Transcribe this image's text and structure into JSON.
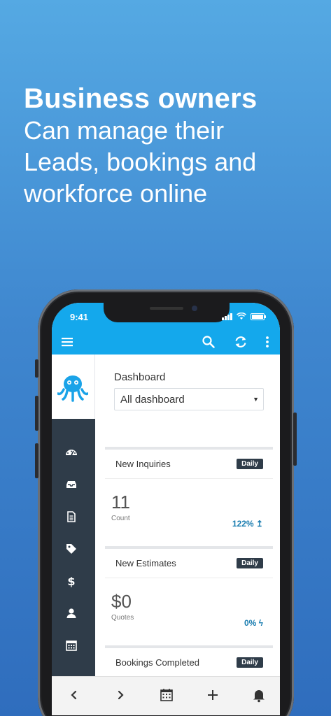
{
  "promo": {
    "headline": "Business owners",
    "subheadline": "Can manage their\nLeads, bookings and\nworkforce online"
  },
  "status_bar": {
    "time": "9:41"
  },
  "colors": {
    "brand": "#14a8ec",
    "sidebar": "#2f3c49",
    "accent_text": "#1a7db0"
  },
  "app_bar": {
    "icons": [
      "menu-icon",
      "search-icon",
      "refresh-icon",
      "more-vert-icon"
    ]
  },
  "sidebar": {
    "logo": "octopus-logo",
    "items": [
      "dashboard-icon",
      "inbox-icon",
      "document-icon",
      "tag-icon",
      "dollar-icon",
      "user-icon",
      "calendar-icon"
    ]
  },
  "dashboard": {
    "title": "Dashboard",
    "selector_value": "All dashboard"
  },
  "cards": [
    {
      "title": "New Inquiries",
      "badge": "Daily",
      "value": "11",
      "label": "Count",
      "change": "122% ↥"
    },
    {
      "title": "New Estimates",
      "badge": "Daily",
      "value": "$0",
      "label": "Quotes",
      "change": "0% ϟ"
    },
    {
      "title": "Bookings Completed",
      "badge": "Daily"
    }
  ],
  "bottom_bar": {
    "icons": [
      "back-icon",
      "forward-icon",
      "calendar-icon",
      "add-icon",
      "bell-icon"
    ]
  }
}
